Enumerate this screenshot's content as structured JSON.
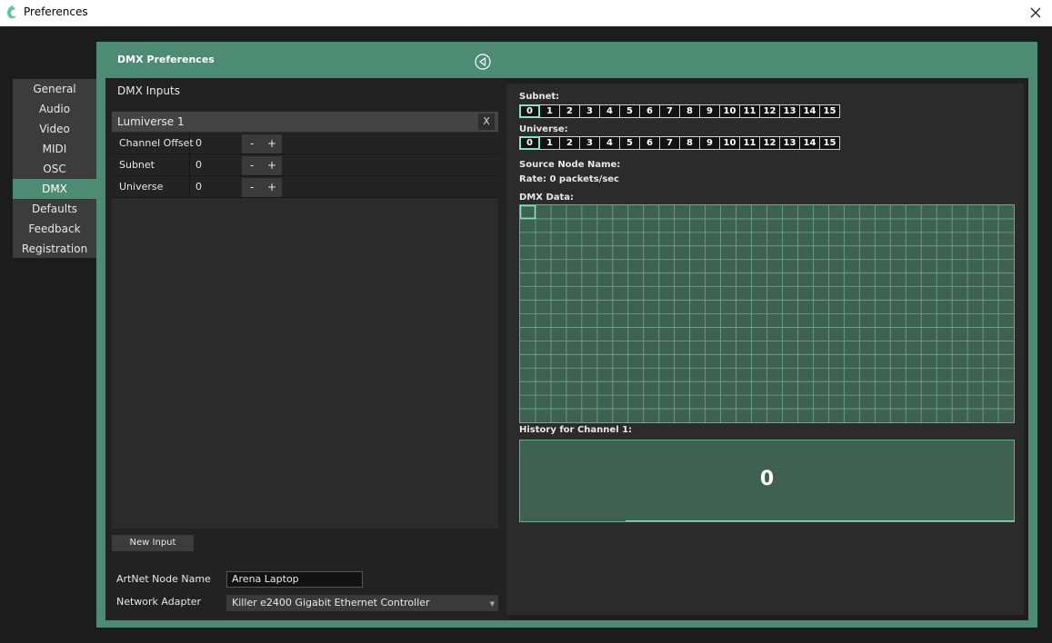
{
  "window": {
    "title": "Preferences"
  },
  "sidebar": {
    "items": [
      {
        "label": "General",
        "active": false
      },
      {
        "label": "Audio",
        "active": false
      },
      {
        "label": "Video",
        "active": false
      },
      {
        "label": "MIDI",
        "active": false
      },
      {
        "label": "OSC",
        "active": false
      },
      {
        "label": "DMX",
        "active": true
      },
      {
        "label": "Defaults",
        "active": false
      },
      {
        "label": "Feedback",
        "active": false
      },
      {
        "label": "Registration",
        "active": false
      }
    ]
  },
  "panel": {
    "title": "DMX Preferences",
    "inputs": {
      "heading": "DMX Inputs",
      "items": [
        {
          "name": "Lumiverse 1",
          "remove_label": "X",
          "params": [
            {
              "label": "Channel Offset",
              "value": "0"
            },
            {
              "label": "Subnet",
              "value": "0"
            },
            {
              "label": "Universe",
              "value": "0"
            }
          ]
        }
      ],
      "stepper": {
        "minus": "-",
        "plus": "+"
      },
      "new_input_label": "New Input"
    },
    "artnet": {
      "label": "ArtNet Node Name",
      "value": "Arena Laptop"
    },
    "adapter": {
      "label": "Network Adapter",
      "value": "Killer e2400 Gigabit Ethernet Controller"
    },
    "monitor": {
      "subnet_label": "Subnet:",
      "subnet_values": [
        "0",
        "1",
        "2",
        "3",
        "4",
        "5",
        "6",
        "7",
        "8",
        "9",
        "10",
        "11",
        "12",
        "13",
        "14",
        "15"
      ],
      "subnet_selected": 0,
      "universe_label": "Universe:",
      "universe_values": [
        "0",
        "1",
        "2",
        "3",
        "4",
        "5",
        "6",
        "7",
        "8",
        "9",
        "10",
        "11",
        "12",
        "13",
        "14",
        "15"
      ],
      "universe_selected": 0,
      "source_label": "Source Node Name:",
      "rate_label": "Rate: 0 packets/sec",
      "dmx_data_label": "DMX Data:",
      "dmx_grid": {
        "columns": 32,
        "rows": 16,
        "selected_channel": 1
      },
      "history_label": "History for Channel 1:",
      "history_value": "0"
    }
  },
  "colors": {
    "accent": "#4e8b74",
    "grid_fill": "#3f6152",
    "grid_line": "#6fa892",
    "selected_outline": "#8de0c4"
  }
}
